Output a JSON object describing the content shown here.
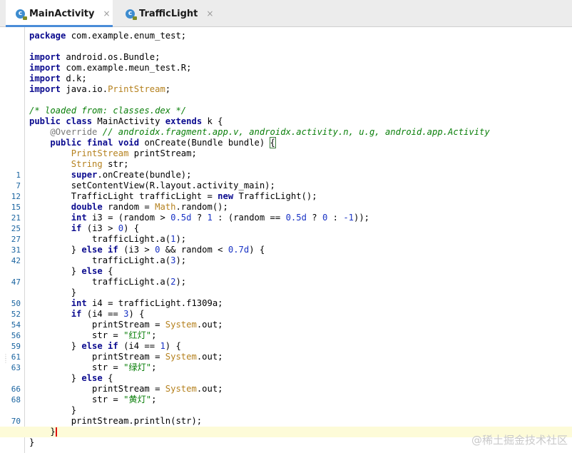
{
  "tabs": [
    {
      "label": "MainActivity",
      "close": "×",
      "icon": "class-file-icon"
    },
    {
      "label": "TrafficLight",
      "close": "×",
      "icon": "class-file-icon"
    }
  ],
  "icon_letter": "c",
  "lines": [
    {
      "ln": "",
      "html": "<span class='kw'>package</span> com.example.enum_test;"
    },
    {
      "ln": "",
      "html": ""
    },
    {
      "ln": "",
      "html": "<span class='kw'>import</span> android.os.Bundle;"
    },
    {
      "ln": "",
      "html": "<span class='kw'>import</span> com.example.meun_test.R;"
    },
    {
      "ln": "",
      "html": "<span class='kw'>import</span> d.k;"
    },
    {
      "ln": "",
      "html": "<span class='kw'>import</span> java.io.<span class='typ'>PrintStream</span>;"
    },
    {
      "ln": "",
      "html": ""
    },
    {
      "ln": "",
      "html": "<span class='cmt'>/* loaded from: classes.dex */</span>"
    },
    {
      "ln": "",
      "html": "<span class='kw'>public class</span> MainActivity <span class='kw'>extends</span> k {"
    },
    {
      "ln": "",
      "html": "    <span class='ann'>@Override</span> <span class='cmt'>// androidx.fragment.app.v, androidx.activity.n, u.g, android.app.Activity</span>"
    },
    {
      "ln": "",
      "html": "    <span class='kw'>public final void</span> onCreate(Bundle bundle) <span class='bracehl'>{</span>"
    },
    {
      "ln": "",
      "html": "        <span class='typ'>PrintStream</span> printStream;"
    },
    {
      "ln": "",
      "html": "        <span class='typ'>String</span> str;"
    },
    {
      "ln": "1",
      "html": "        <span class='kw'>super</span>.onCreate(bundle);"
    },
    {
      "ln": "7",
      "html": "        setContentView(R.layout.activity_main);"
    },
    {
      "ln": "12",
      "html": "        TrafficLight trafficLight = <span class='kw'>new</span> TrafficLight();"
    },
    {
      "ln": "15",
      "html": "        <span class='kw'>double</span> random = <span class='typ'>Math</span>.random();"
    },
    {
      "ln": "21",
      "html": "        <span class='kw'>int</span> i3 = (random &gt; <span class='num'>0.5d</span> ? <span class='num'>1</span> : (random == <span class='num'>0.5d</span> ? <span class='num'>0</span> : <span class='num'>-1</span>));"
    },
    {
      "ln": "25",
      "html": "        <span class='kw'>if</span> (i3 &gt; <span class='num'>0</span>) {"
    },
    {
      "ln": "27",
      "html": "            trafficLight.a(<span class='num'>1</span>);"
    },
    {
      "ln": "31",
      "html": "        } <span class='kw'>else if</span> (i3 &gt; <span class='num'>0</span> &amp;&amp; random &lt; <span class='num'>0.7d</span>) {"
    },
    {
      "ln": "42",
      "html": "            trafficLight.a(<span class='num'>3</span>);"
    },
    {
      "ln": "",
      "html": "        } <span class='kw'>else</span> {"
    },
    {
      "ln": "47",
      "html": "            trafficLight.a(<span class='num'>2</span>);"
    },
    {
      "ln": "",
      "html": "        }"
    },
    {
      "ln": "50",
      "html": "        <span class='kw'>int</span> i4 = trafficLight.f1309a;"
    },
    {
      "ln": "52",
      "html": "        <span class='kw'>if</span> (i4 == <span class='num'>3</span>) {"
    },
    {
      "ln": "54",
      "html": "            printStream = <span class='typ'>System</span>.out;"
    },
    {
      "ln": "56",
      "html": "            str = <span class='str'>\"红灯\"</span>;"
    },
    {
      "ln": "59",
      "html": "        } <span class='kw'>else if</span> (i4 == <span class='num'>1</span>) {"
    },
    {
      "ln": "61",
      "html": "            printStream = <span class='typ'>System</span>.out;"
    },
    {
      "ln": "63",
      "html": "            str = <span class='str'>\"绿灯\"</span>;"
    },
    {
      "ln": "",
      "html": "        } <span class='kw'>else</span> {"
    },
    {
      "ln": "66",
      "html": "            printStream = <span class='typ'>System</span>.out;"
    },
    {
      "ln": "68",
      "html": "            str = <span class='str'>\"黄灯\"</span>;"
    },
    {
      "ln": "",
      "html": "        }"
    },
    {
      "ln": "70",
      "html": "        printStream.println(str);"
    },
    {
      "ln": "",
      "html": "    }<span class='caret'></span>"
    },
    {
      "ln": "",
      "html": "}"
    }
  ],
  "current_line_index": 37,
  "watermark": "@稀土掘金技术社区"
}
